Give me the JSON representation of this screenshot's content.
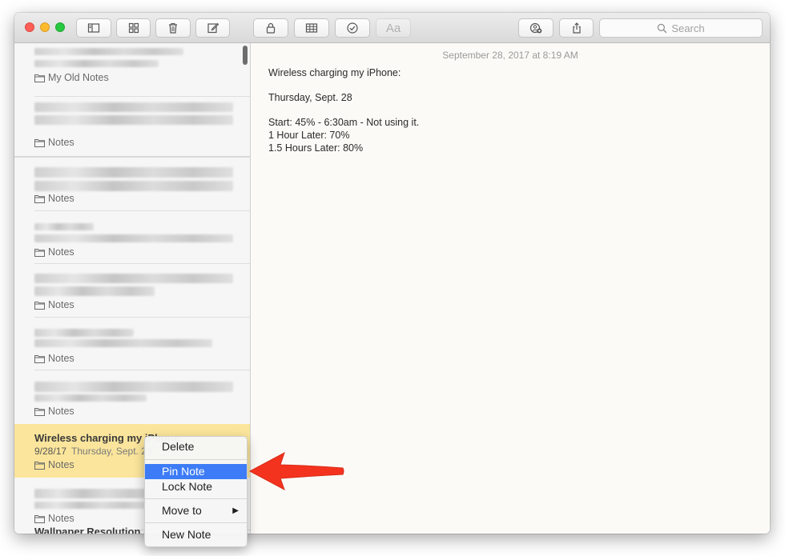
{
  "toolbar": {
    "buttons": [
      "sidebar-toggle-icon",
      "attachments-grid-icon",
      "trash-icon",
      "compose-icon",
      "lock-icon",
      "table-icon",
      "checklist-icon",
      "format-text-icon",
      "collaborate-icon",
      "share-icon"
    ],
    "format_label": "Aa",
    "search_placeholder": "Search"
  },
  "sidebar": {
    "notes": [
      {
        "folder": "My Old Notes"
      },
      {
        "folder": "Notes"
      },
      {
        "folder": "Notes"
      },
      {
        "folder": "Notes"
      },
      {
        "folder": "Notes"
      },
      {
        "folder": "Notes"
      },
      {
        "folder": "Notes"
      },
      {
        "title": "Wireless charging my iPhone:",
        "date": "9/28/17",
        "preview": "Thursday, Sept. 28",
        "folder": "Notes",
        "selected": true
      },
      {
        "folder": "Notes"
      },
      {
        "title": "Wallpaper Resolution"
      }
    ]
  },
  "note": {
    "timestamp": "September 28, 2017 at 8:19 AM",
    "lines": [
      "Wireless charging my iPhone:",
      "",
      "Thursday, Sept. 28",
      "",
      "Start: 45% - 6:30am - Not using it.",
      "1 Hour Later: 70%",
      "1.5 Hours Later: 80%"
    ]
  },
  "context_menu": {
    "items": [
      "Delete",
      "Pin Note",
      "Lock Note",
      "Move to",
      "New Note"
    ],
    "highlighted": "Pin Note"
  },
  "colors": {
    "selected_note": "#fbe59c",
    "menu_highlight": "#3d7cf6",
    "annotation_arrow": "#f4331f"
  }
}
